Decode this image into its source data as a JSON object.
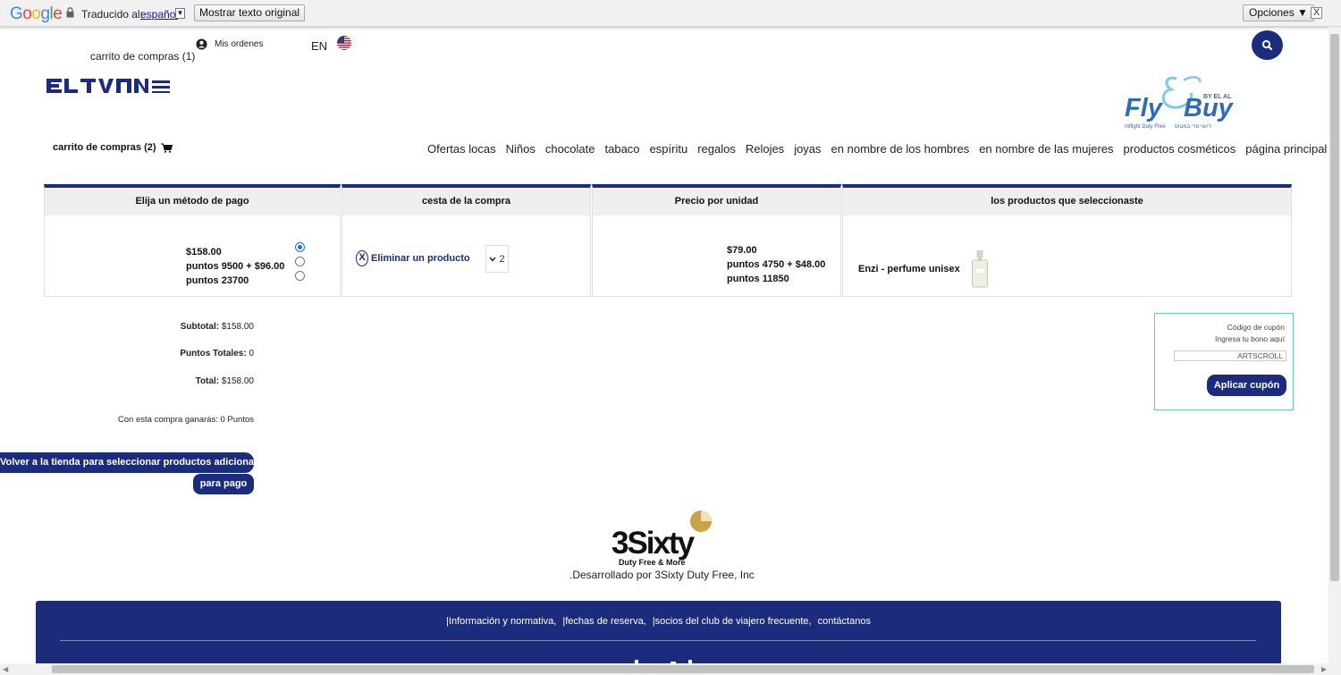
{
  "google_bar": {
    "logo": "Google",
    "translated_label": "Traducido al:",
    "language": "español",
    "dropdown": "▼",
    "show_original": "Mostrar texto original",
    "options": "Opciones ▼",
    "close": "X"
  },
  "header": {
    "cart_top": "carrito de compras (1)",
    "my_orders": "Mis ordenes",
    "lang": "EN",
    "cart_main": "carrito de compras (2)"
  },
  "nav": {
    "items": [
      "Ofertas locas",
      "Niños",
      "chocolate",
      "tabaco",
      "espíritu",
      "regalos",
      "Relojes",
      "joyas",
      "en nombre de los hombres",
      "en nombre de las mujeres",
      "productos cosméticos",
      "página principal"
    ]
  },
  "table": {
    "headers": {
      "payment": "Elija un método de pago",
      "basket": "cesta de la compra",
      "unit_price": "Precio por unidad",
      "products": "los productos que seleccionaste"
    },
    "payment_options": [
      "$158.00",
      "puntos 9500 + $96.00",
      "puntos 23700"
    ],
    "selected_payment_index": 0,
    "remove_icon": "X",
    "remove_label": "Eliminar un producto",
    "quantity": "2",
    "unit_prices": [
      "$79.00",
      "puntos 4750 + $48.00",
      "puntos 11850"
    ],
    "product_name": "Enzi - perfume unisex"
  },
  "totals": {
    "subtotal_label": "Subtotal:",
    "subtotal_value": "$158.00",
    "points_label": "Puntos Totales:",
    "points_value": "0",
    "total_label": "Total:",
    "total_value": "$158.00",
    "earn_text": "Con esta compra ganarás: 0 Puntos"
  },
  "buttons": {
    "back_to_store": "Volver a la tienda para seleccionar productos adicionales",
    "to_payment": "para pago"
  },
  "coupon": {
    "title": "Código de cupón",
    "subtitle": "Ingresa tu bono aquí",
    "value": "ARTSCROLL",
    "apply": "Aplicar cupón"
  },
  "footer": {
    "developed_by": ".Desarrollado por 3Sixty Duty Free, Inc",
    "links": [
      "|Información y normativa,",
      "|fechas de reserva,",
      "|socios del club de viajero frecuente,",
      "contáctanos"
    ]
  },
  "colors": {
    "brand_navy": "#1c2c7c",
    "coupon_border": "#66c7d0",
    "flybuy_blue": "#2e6bb8"
  }
}
